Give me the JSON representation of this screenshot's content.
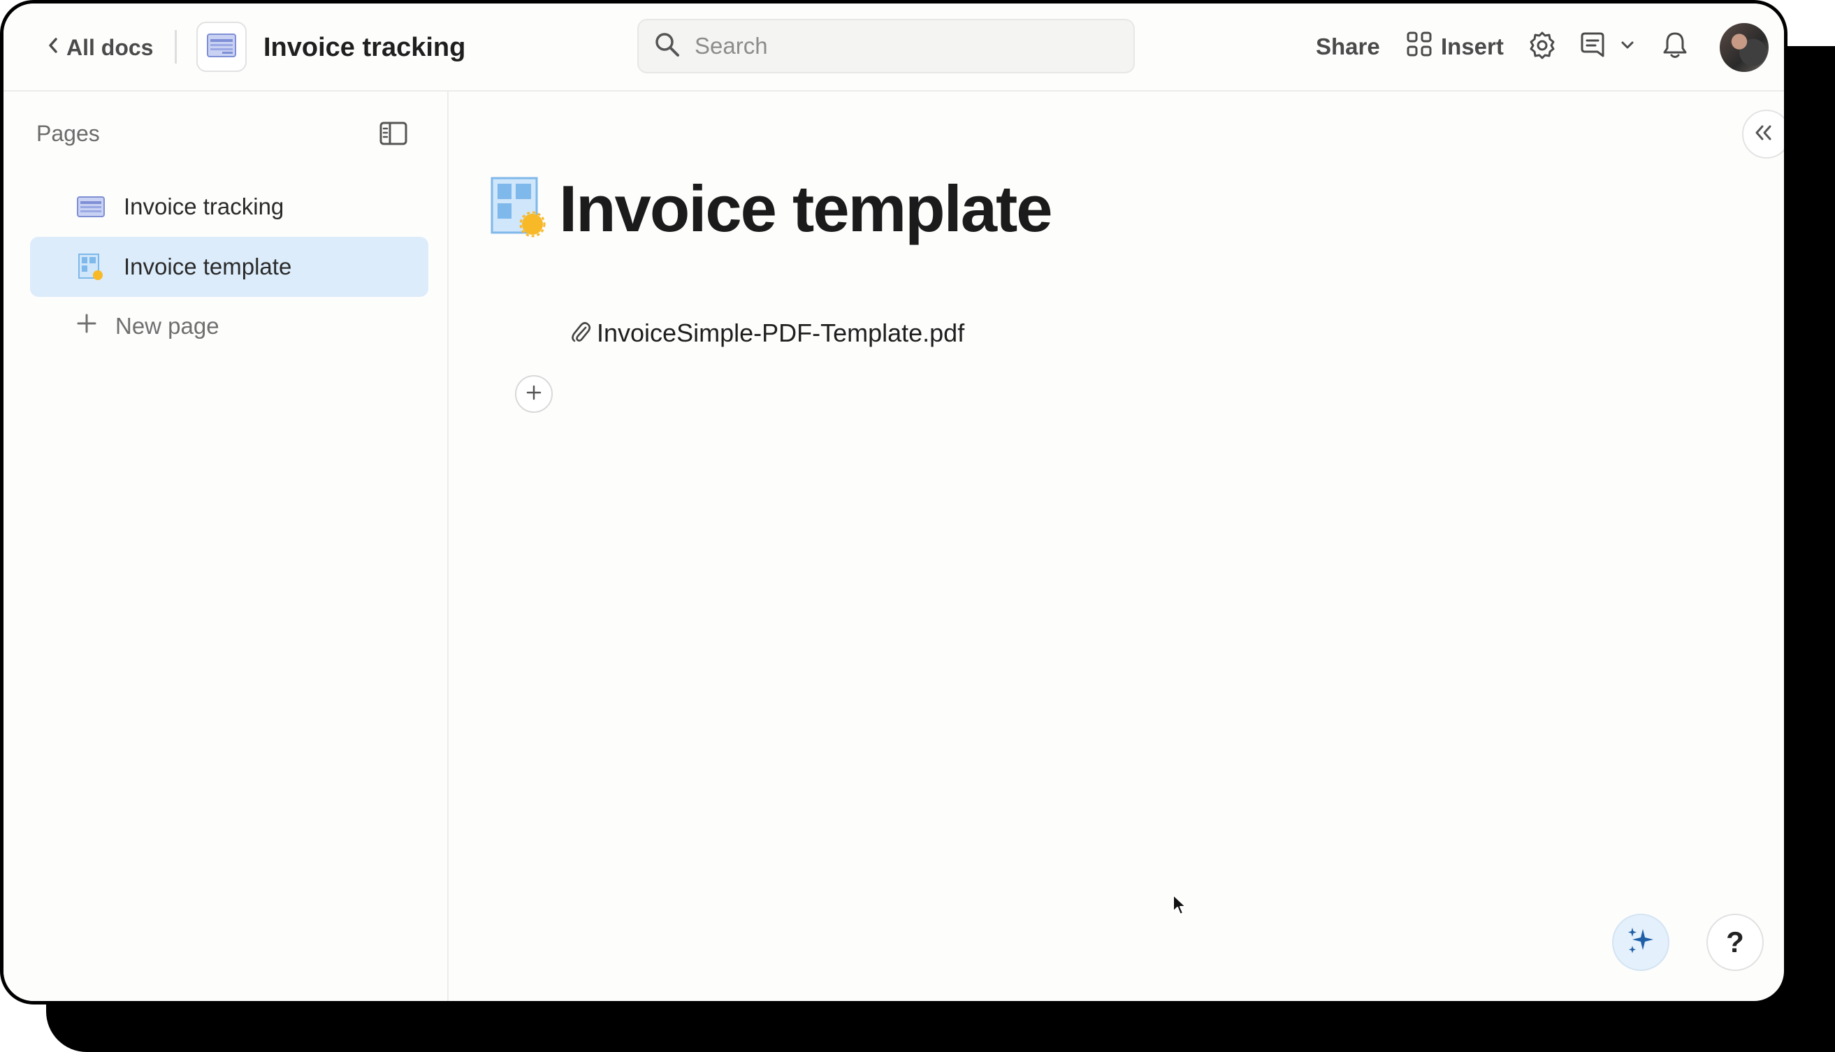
{
  "header": {
    "back_label": "All docs",
    "doc_title": "Invoice tracking",
    "search_placeholder": "Search",
    "share_label": "Share",
    "insert_label": "Insert"
  },
  "sidebar": {
    "pages_label": "Pages",
    "items": [
      {
        "label": "Invoice tracking",
        "icon": "table-doc-icon",
        "active": false
      },
      {
        "label": "Invoice template",
        "icon": "template-page-icon",
        "active": true
      }
    ],
    "new_page_label": "New page"
  },
  "main": {
    "page_title": "Invoice template",
    "attachment_name": "InvoiceSimple-PDF-Template.pdf",
    "help_label": "?"
  },
  "colors": {
    "active_item_bg": "#dcecfb",
    "accent_blue": "#1f5fa8",
    "icon_yellow": "#f7b928",
    "icon_light_blue": "#8fc4ef"
  }
}
